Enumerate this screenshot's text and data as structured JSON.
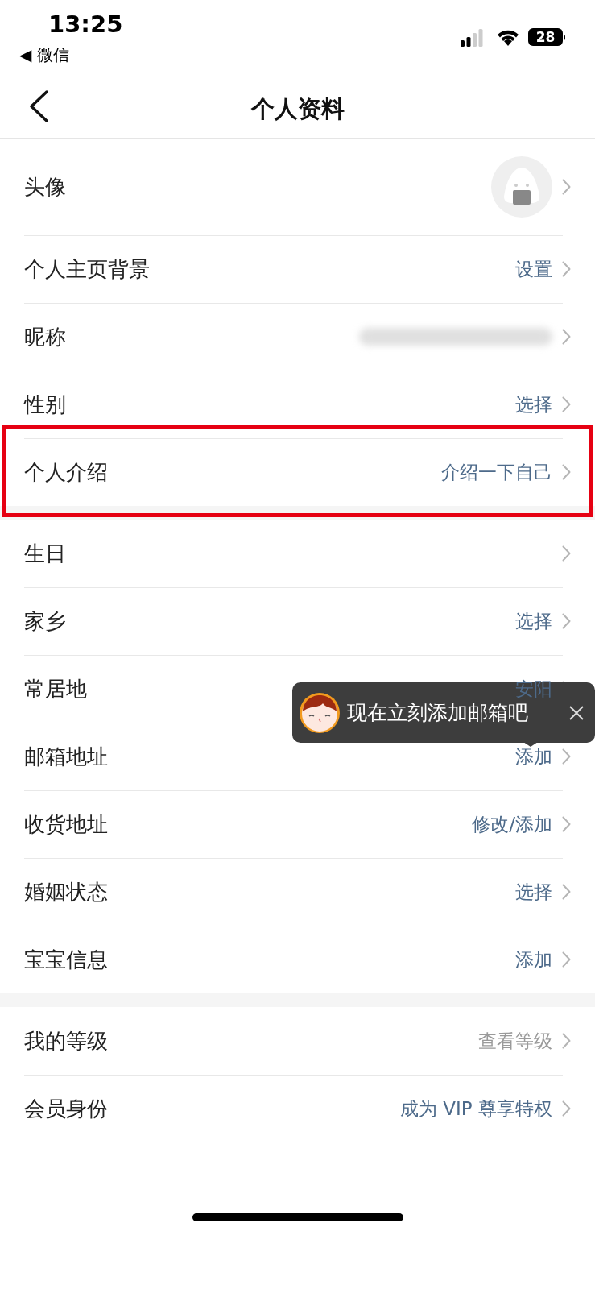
{
  "status_bar": {
    "time": "13:25",
    "back_app": "◀ 微信",
    "battery": "28"
  },
  "header": {
    "title": "个人资料"
  },
  "sections": [
    {
      "rows": [
        {
          "label": "头像",
          "kind": "avatar",
          "highlighted": false
        },
        {
          "label": "个人主页背景",
          "kind": "text",
          "value": "设置",
          "muted": false,
          "highlighted": false
        },
        {
          "label": "昵称",
          "kind": "blurred",
          "highlighted": false
        },
        {
          "label": "性别",
          "kind": "text",
          "value": "选择",
          "muted": false,
          "highlighted": false
        },
        {
          "label": "个人介绍",
          "kind": "text",
          "value": "介绍一下自己",
          "muted": false,
          "highlighted": true
        }
      ]
    },
    {
      "rows": [
        {
          "label": "生日",
          "kind": "none",
          "highlighted": false
        },
        {
          "label": "家乡",
          "kind": "text",
          "value": "选择",
          "muted": false,
          "highlighted": false
        },
        {
          "label": "常居地",
          "kind": "text",
          "value": "安阳",
          "muted": false,
          "highlighted": false
        },
        {
          "label": "邮箱地址",
          "kind": "text",
          "value": "添加",
          "muted": false,
          "highlighted": false
        },
        {
          "label": "收货地址",
          "kind": "text",
          "value": "修改/添加",
          "muted": false,
          "highlighted": false
        },
        {
          "label": "婚姻状态",
          "kind": "text",
          "value": "选择",
          "muted": false,
          "highlighted": false
        },
        {
          "label": "宝宝信息",
          "kind": "text",
          "value": "添加",
          "muted": false,
          "highlighted": false
        }
      ]
    },
    {
      "rows": [
        {
          "label": "我的等级",
          "kind": "text",
          "value": "查看等级",
          "muted": true,
          "highlighted": false
        },
        {
          "label": "会员身份",
          "kind": "text",
          "value": "成为 VIP 尊享特权",
          "muted": false,
          "highlighted": false
        }
      ]
    }
  ],
  "tooltip": {
    "text": "现在立刻添加邮箱吧"
  }
}
